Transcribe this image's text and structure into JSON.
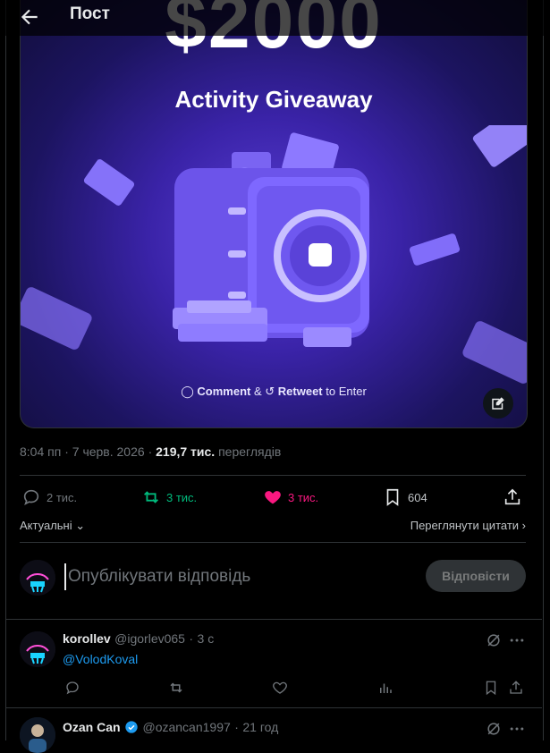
{
  "header": {
    "title": "Пост"
  },
  "media": {
    "amount": "$2000",
    "subtitle": "Activity Giveaway",
    "cta_comment": "Comment",
    "cta_and": " & ",
    "cta_retweet": "Retweet",
    "cta_end": " to Enter"
  },
  "meta": {
    "time": "8:04 пп",
    "date": "7 черв. 2026",
    "views": "219,7 тис.",
    "views_label": "переглядів"
  },
  "stats": {
    "replies": "2 тис.",
    "reposts": "3 тис.",
    "likes": "3 тис.",
    "bookmarks": "604"
  },
  "sort": {
    "left": "Актуальні",
    "right": "Переглянути цитати"
  },
  "composer": {
    "placeholder": "Опублікувати відповідь",
    "button": "Відповісти"
  },
  "replies": [
    {
      "name": "korollev",
      "handle": "@igorlev065",
      "time": "3 с",
      "text": "@VolodKoval"
    },
    {
      "name": "Ozan Can",
      "handle": "@ozancan1997",
      "time": "21 год"
    }
  ],
  "colors": {
    "accent": "#1d9bf0",
    "repost": "#00ba7c",
    "like": "#f91880"
  }
}
